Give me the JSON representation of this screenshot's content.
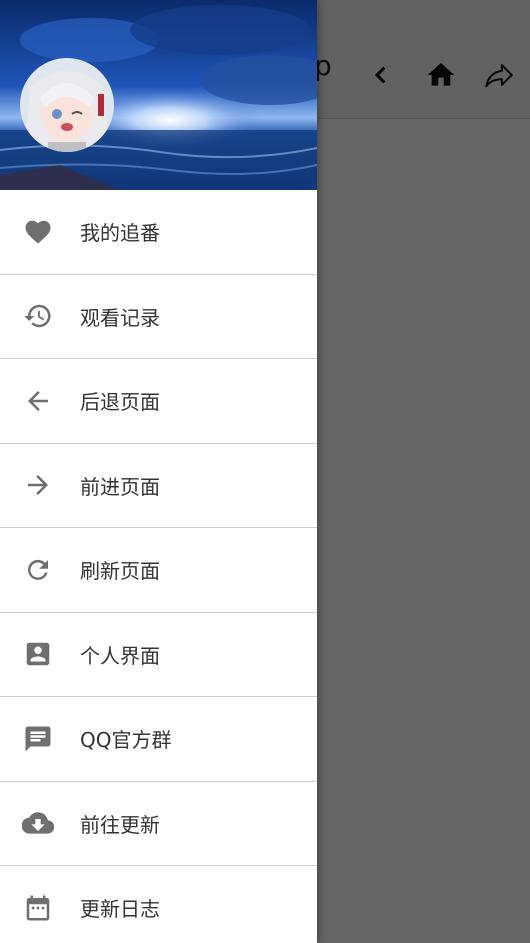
{
  "app": {
    "title_fragment": "p"
  },
  "appbar": {
    "icons": [
      "chevron-left-icon",
      "home-icon",
      "share-icon"
    ]
  },
  "drawer": {
    "items": [
      {
        "label": "我的追番",
        "icon": "heart-icon"
      },
      {
        "label": "观看记录",
        "icon": "history-icon"
      },
      {
        "label": "后退页面",
        "icon": "arrow-left-icon"
      },
      {
        "label": "前进页面",
        "icon": "arrow-right-icon"
      },
      {
        "label": "刷新页面",
        "icon": "refresh-icon"
      },
      {
        "label": "个人界面",
        "icon": "account-box-icon"
      },
      {
        "label": "QQ官方群",
        "icon": "message-icon"
      },
      {
        "label": "前往更新",
        "icon": "cloud-download-icon"
      },
      {
        "label": "更新日志",
        "icon": "calendar-icon"
      }
    ]
  },
  "colors": {
    "icon_gray": "#6f6f6f",
    "scrim": "#6b6b6b",
    "header_sky": "#1c3f8f"
  }
}
